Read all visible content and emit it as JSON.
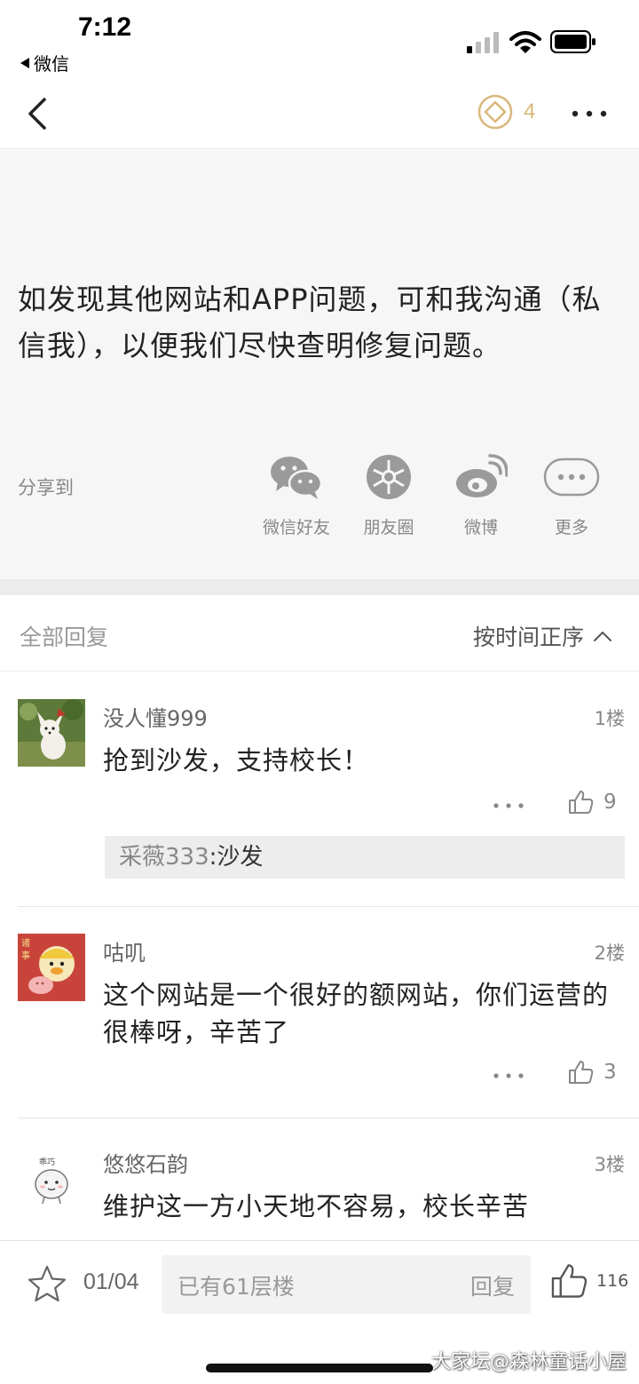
{
  "status_bar": {
    "time": "7:12",
    "back_app": "微信"
  },
  "nav": {
    "coin_count": "4",
    "back_icon": "chevron-left-icon",
    "more_icon": "more-dots-icon"
  },
  "article": {
    "text": "如发现其他网站和APP问题，可和我沟通（私信我），以便我们尽快查明修复问题。"
  },
  "share": {
    "label": "分享到",
    "items": [
      {
        "label": "微信好友",
        "icon": "wechat-icon"
      },
      {
        "label": "朋友圈",
        "icon": "moments-icon"
      },
      {
        "label": "微博",
        "icon": "weibo-icon"
      },
      {
        "label": "更多",
        "icon": "more-icon"
      }
    ]
  },
  "replies": {
    "title": "全部回复",
    "sort_label": "按时间正序",
    "items": [
      {
        "name": "没人懂999",
        "floor": "1楼",
        "body": "抢到沙发，支持校长！",
        "likes": "9",
        "subreply": {
          "user": "采薇333",
          "text": ":沙发"
        }
      },
      {
        "name": "咕叽",
        "floor": "2楼",
        "body": "这个网站是一个很好的额网站，你们运营的很棒呀，辛苦了",
        "likes": "3"
      },
      {
        "name": "悠悠石韵",
        "floor": "3楼",
        "body": "维护这一方小天地不容易，校长辛苦"
      }
    ]
  },
  "bottom_bar": {
    "page": "01/04",
    "input_placeholder": "已有61层楼",
    "reply_button": "回复",
    "like_total": "116",
    "watermark": "大家坛@森林童话小屋"
  },
  "colors": {
    "accent_gold": "#d9b77a",
    "muted_text": "#888888",
    "article_bg": "#f6f6f6"
  }
}
